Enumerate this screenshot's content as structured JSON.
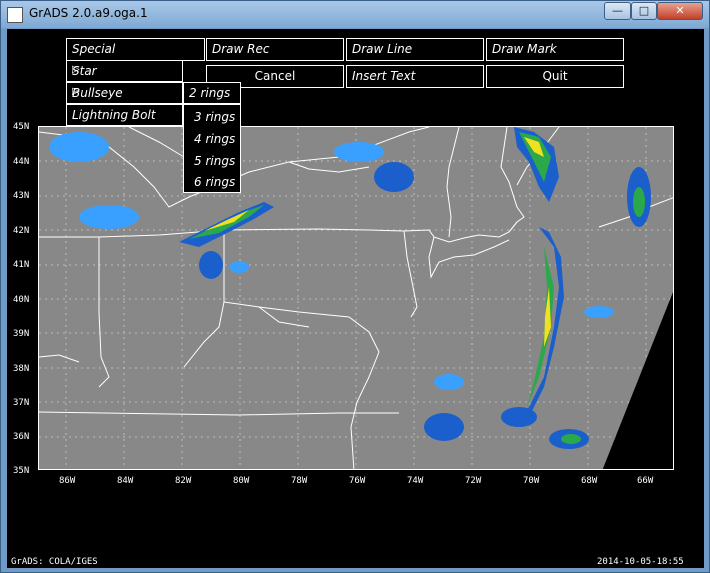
{
  "window": {
    "title": "GrADS 2.0.a9.oga.1"
  },
  "toolbar": {
    "special": "Special",
    "draw_rec": "Draw Rec",
    "draw_line": "Draw Line",
    "draw_mark": "Draw Mark",
    "cancel": "Cancel",
    "insert_text": "Insert Text",
    "quit": "Quit"
  },
  "special_menu": {
    "items": [
      "Star",
      "Bullseye",
      "Lightning Bolt"
    ]
  },
  "bullseye_submenu": {
    "items": [
      "2 rings",
      "3 rings",
      "4 rings",
      "5 rings",
      "6 rings"
    ]
  },
  "axes": {
    "lat_labels": [
      "45N",
      "44N",
      "43N",
      "42N",
      "41N",
      "40N",
      "39N",
      "38N",
      "37N",
      "36N",
      "35N"
    ],
    "lon_labels": [
      "86W",
      "84W",
      "82W",
      "80W",
      "78W",
      "76W",
      "74W",
      "72W",
      "70W",
      "68W",
      "66W"
    ]
  },
  "footer": {
    "left": "GrADS: COLA/IGES",
    "right": "2014-10-05-18:55"
  },
  "colors": {
    "background": "#000000",
    "plot_fill": "#888888",
    "frame": "#3a5f88"
  }
}
